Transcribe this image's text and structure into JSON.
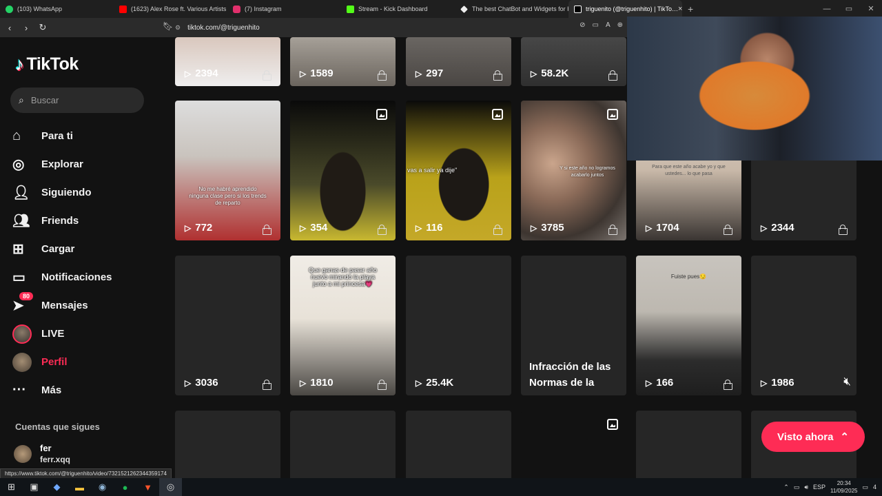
{
  "browser": {
    "tabs": [
      {
        "label": "(103) WhatsApp",
        "color": "#25d366"
      },
      {
        "label": "(1623) Alex Rose ft. Various Artists - …",
        "color": "#ff0000"
      },
      {
        "label": "(7) Instagram",
        "color": "#e1306c"
      },
      {
        "label": "Stream - Kick Dashboard",
        "color": "#53fc18"
      },
      {
        "label": "The best ChatBot and Widgets for K…",
        "color": "#ffffff"
      },
      {
        "label": "triguenito (@triguenhito) | TikTo…",
        "color": "#ffffff"
      }
    ],
    "url": "tiktok.com/@triguenhito",
    "status_url": "https://www.tiktok.com/@triguenhito/video/7321521262344359174"
  },
  "sidebar": {
    "logo": "TikTok",
    "search_placeholder": "Buscar",
    "items": [
      {
        "label": "Para ti",
        "icon": "home-icon"
      },
      {
        "label": "Explorar",
        "icon": "compass-icon"
      },
      {
        "label": "Siguiendo",
        "icon": "following-icon"
      },
      {
        "label": "Friends",
        "icon": "friends-icon"
      },
      {
        "label": "Cargar",
        "icon": "upload-icon"
      },
      {
        "label": "Notificaciones",
        "icon": "notifications-icon"
      },
      {
        "label": "Mensajes",
        "icon": "messages-icon",
        "badge": "80"
      },
      {
        "label": "LIVE",
        "icon": "live-avatar"
      },
      {
        "label": "Perfil",
        "icon": "profile-avatar"
      },
      {
        "label": "Más",
        "icon": "more-icon"
      }
    ],
    "following_title": "Cuentas que sigues",
    "following": [
      {
        "name": "fer",
        "handle": "ferr.xqq"
      }
    ]
  },
  "videos": {
    "row0": [
      "2394",
      "1589",
      "297",
      "58.2K"
    ],
    "row1": [
      {
        "views": "772",
        "caption": "No me habré aprendido ninguna clase pero si los trends de reparto"
      },
      {
        "views": "354",
        "caption": ""
      },
      {
        "views": "116",
        "caption": "vas a salir ya dije\""
      },
      {
        "views": "3785",
        "caption": "Y si este año no logramos acabarlo juntos"
      },
      {
        "views": "1704",
        "caption": "Para que este año acabe yo y que ustedes... lo que pasa"
      },
      {
        "views": "2344",
        "caption": ""
      }
    ],
    "row2": [
      {
        "views": "3036",
        "caption": ""
      },
      {
        "views": "1810",
        "caption": "Que ganas de pasar año nuevo mirando la playa junto a mi princesa💗"
      },
      {
        "views": "25.4K",
        "caption": ""
      },
      {
        "views": "",
        "caption": "Infracción de las Normas de la"
      },
      {
        "views": "166",
        "caption": "Fuiste pues😏"
      },
      {
        "views": "1986",
        "caption": ""
      }
    ]
  },
  "visto_ahora": "Visto ahora",
  "taskbar": {
    "lang": "ESP",
    "time": "20:34",
    "date": "11/09/2025",
    "notif_count": "4"
  }
}
